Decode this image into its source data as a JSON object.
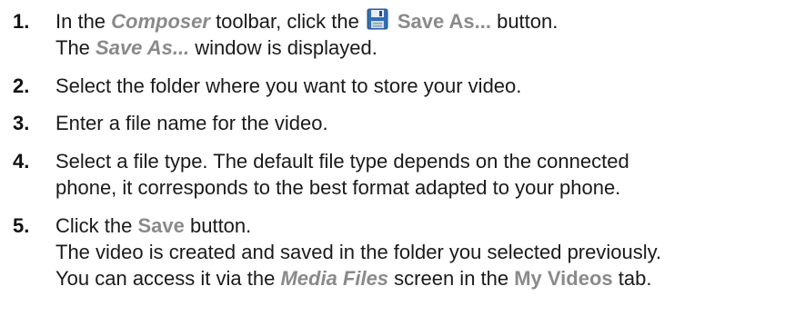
{
  "steps": [
    {
      "number": "1.",
      "line1_a": "In the ",
      "composer": "Composer",
      "line1_b": " toolbar, click the",
      "icon": "floppy-disk-save-icon",
      "save_as_button": "Save As...",
      "line1_c": " button.",
      "save_as_window": "Save As...",
      "line2_b": " window is displayed.",
      "line2_a": "The "
    },
    {
      "number": "2.",
      "text": "Select the folder where you want to store your video."
    },
    {
      "number": "3.",
      "text": "Enter a file name for the video."
    },
    {
      "number": "4.",
      "line1": "Select a file type. The default file type depends on the connected",
      "line2": "phone, it corresponds to the best format adapted to your phone."
    },
    {
      "number": "5.",
      "line1_a": "Click the ",
      "save_button": "Save",
      "line1_b": " button.",
      "line2": "The video is created and saved in the folder you selected previously.",
      "line3_a": "You can access it via the ",
      "media_files": "Media Files",
      "line3_b": " screen in the ",
      "my_videos": "My Videos",
      "line3_c": " tab."
    }
  ],
  "colors": {
    "text": "#1a1a1a",
    "ui_reference": "#8a8a8a",
    "icon_blue": "#2f6fb8"
  }
}
